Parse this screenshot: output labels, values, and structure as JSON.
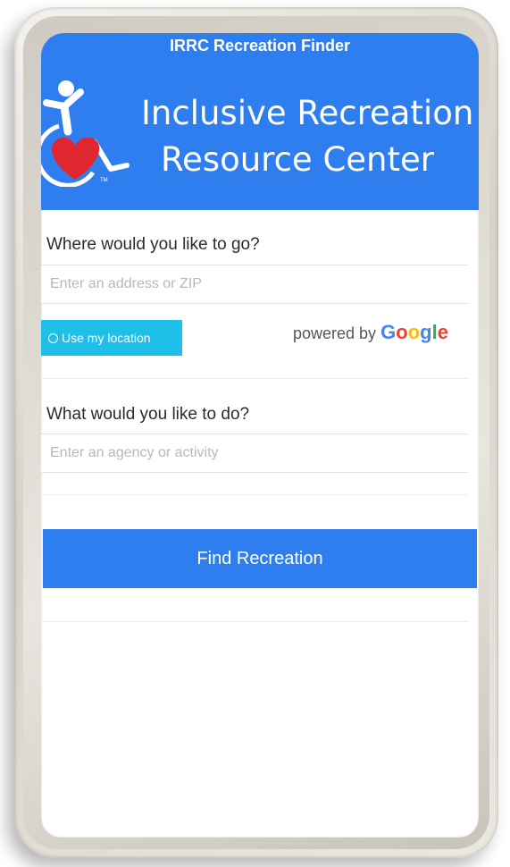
{
  "app": {
    "title": "IRRC Recreation Finder",
    "brand_line1": "Inclusive Recreation",
    "brand_line2": "Resource Center",
    "logo_text": "TM"
  },
  "location": {
    "label": "Where would you like to go?",
    "placeholder": "Enter an address or ZIP",
    "value": "",
    "use_location_label": "Use my location",
    "powered_by": "powered by",
    "google_letters": [
      "G",
      "o",
      "o",
      "g",
      "l",
      "e"
    ]
  },
  "activity": {
    "label": "What would you like to do?",
    "placeholder": "Enter an agency or activity",
    "value": ""
  },
  "actions": {
    "find_label": "Find Recreation"
  },
  "colors": {
    "header_blue": "#2f7ef0",
    "location_button": "#1ec0ea",
    "heart_red": "#e0262f"
  }
}
